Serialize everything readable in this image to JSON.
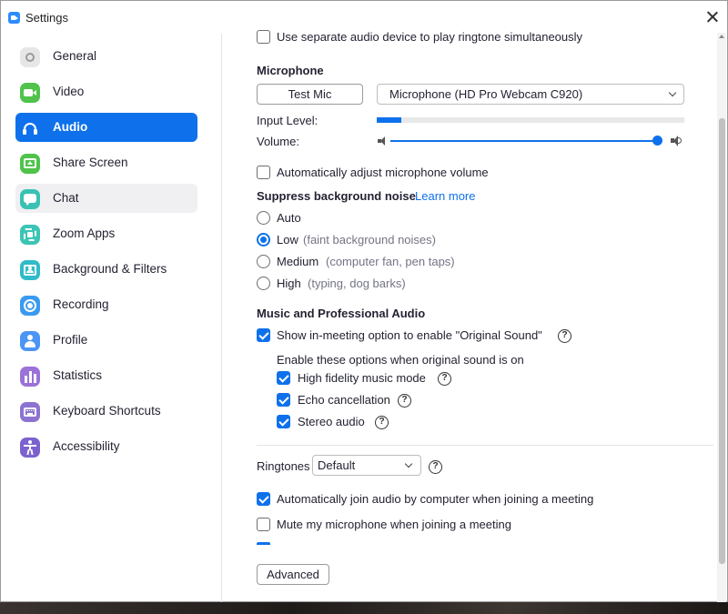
{
  "window": {
    "title": "Settings"
  },
  "sidebar": {
    "items": [
      {
        "label": "General",
        "icon": "gear-icon",
        "color": "#e6e6e6"
      },
      {
        "label": "Video",
        "icon": "video-camera-icon",
        "color": "#4fc34b"
      },
      {
        "label": "Audio",
        "icon": "headphones-icon",
        "color": "#0e71eb",
        "active": true
      },
      {
        "label": "Share Screen",
        "icon": "share-screen-icon",
        "color": "#4fc34b"
      },
      {
        "label": "Chat",
        "icon": "chat-bubble-icon",
        "color": "#39c2b3"
      },
      {
        "label": "Zoom Apps",
        "icon": "zoom-apps-icon",
        "color": "#3cc5b5"
      },
      {
        "label": "Background & Filters",
        "icon": "background-portrait-icon",
        "color": "#30bbc8"
      },
      {
        "label": "Recording",
        "icon": "recording-icon",
        "color": "#3b9af0"
      },
      {
        "label": "Profile",
        "icon": "profile-person-icon",
        "color": "#4b95f5"
      },
      {
        "label": "Statistics",
        "icon": "statistics-bar-chart-icon",
        "color": "#9a72d8"
      },
      {
        "label": "Keyboard Shortcuts",
        "icon": "keyboard-icon",
        "color": "#8d73d0"
      },
      {
        "label": "Accessibility",
        "icon": "accessibility-person-icon",
        "color": "#7b62cf"
      }
    ]
  },
  "content": {
    "separate_device": {
      "label": "Use separate audio device to play ringtone simultaneously",
      "checked": false
    },
    "microphone": {
      "heading": "Microphone",
      "test_button": "Test Mic",
      "device": "Microphone (HD Pro Webcam C920)",
      "input_level_label": "Input Level:",
      "input_level": 0.08,
      "volume_label": "Volume:",
      "volume": 1.0
    },
    "auto_adjust": {
      "label": "Automatically adjust microphone volume",
      "checked": false
    },
    "noise": {
      "heading": "Suppress background noise",
      "learn_more": "Learn more",
      "options": [
        {
          "label": "Auto",
          "hint": "",
          "selected": false
        },
        {
          "label": "Low",
          "hint": "(faint background noises)",
          "selected": true
        },
        {
          "label": "Medium",
          "hint": "(computer fan, pen taps)",
          "selected": false
        },
        {
          "label": "High",
          "hint": "(typing, dog barks)",
          "selected": false
        }
      ]
    },
    "music": {
      "heading": "Music and Professional Audio",
      "original_sound": {
        "label": "Show in-meeting option to enable \"Original Sound\"",
        "checked": true
      },
      "enable_note": "Enable these options when original sound is on",
      "options": [
        {
          "label": "High fidelity music mode",
          "checked": true
        },
        {
          "label": "Echo cancellation",
          "checked": true
        },
        {
          "label": "Stereo audio",
          "checked": true
        }
      ]
    },
    "ringtones": {
      "label": "Ringtones",
      "value": "Default"
    },
    "auto_join": {
      "label": "Automatically join audio by computer when joining a meeting",
      "checked": true
    },
    "mute_on_join": {
      "label": "Mute my microphone when joining a meeting",
      "checked": false
    },
    "advanced_button": "Advanced",
    "help_glyph": "?"
  }
}
